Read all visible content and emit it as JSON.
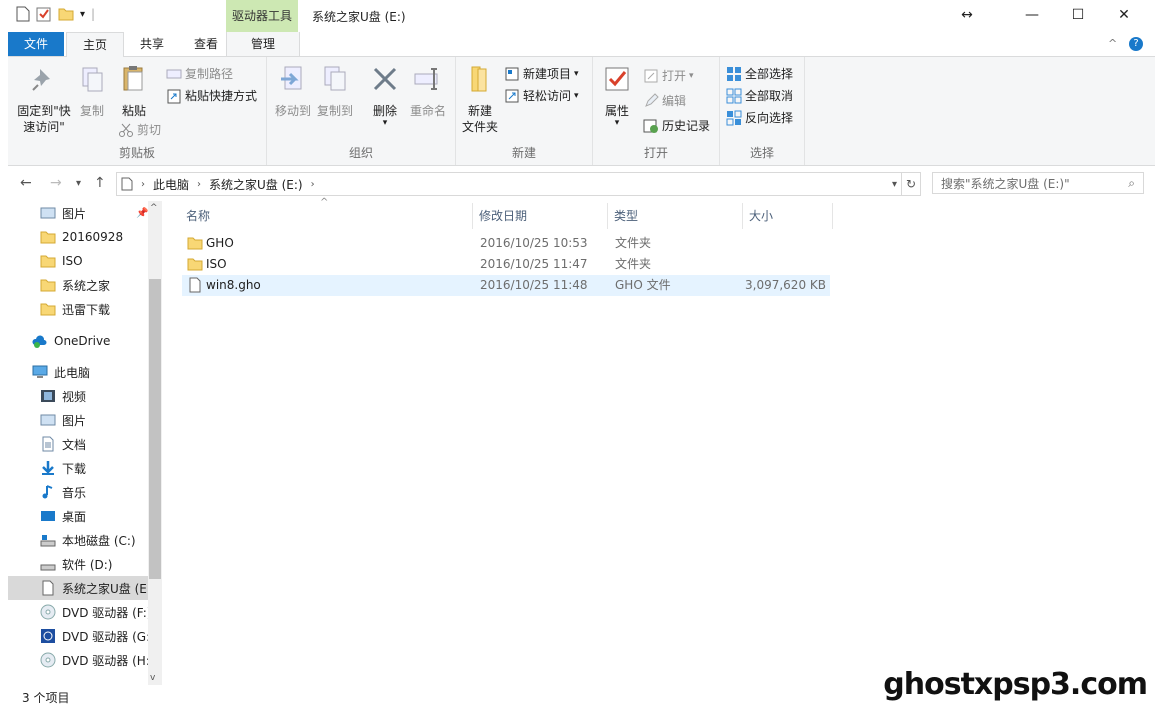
{
  "window": {
    "title": "系统之家U盘 (E:)",
    "tools_header": "驱动器工具",
    "minimize": "—",
    "maximize": "☐",
    "close": "✕",
    "resize_hint": "↔"
  },
  "tabs": {
    "file": "文件",
    "home": "主页",
    "share": "共享",
    "view": "查看",
    "manage": "管理"
  },
  "ribbon": {
    "clipboard": {
      "label": "剪贴板",
      "pin": "固定到\"快",
      "pin2": "速访问\"",
      "copy": "复制",
      "paste": "粘贴",
      "copy_path": "复制路径",
      "paste_shortcut": "粘贴快捷方式",
      "cut": "剪切"
    },
    "organize": {
      "label": "组织",
      "move_to": "移动到",
      "copy_to": "复制到",
      "delete": "删除",
      "rename": "重命名"
    },
    "new": {
      "label": "新建",
      "new_folder": "新建",
      "new_folder2": "文件夹",
      "new_item": "新建项目",
      "easy_access": "轻松访问"
    },
    "open": {
      "label": "打开",
      "properties": "属性",
      "open": "打开",
      "edit": "编辑",
      "history": "历史记录"
    },
    "select": {
      "label": "选择",
      "select_all": "全部选择",
      "select_none": "全部取消",
      "invert": "反向选择"
    }
  },
  "address": {
    "crumbs": [
      "此电脑",
      "系统之家U盘 (E:)"
    ],
    "search_placeholder": "搜索\"系统之家U盘 (E:)\""
  },
  "nav": {
    "quick": [
      "图片",
      "20160928",
      "ISO",
      "系统之家",
      "迅雷下载"
    ],
    "onedrive": "OneDrive",
    "pc": "此电脑",
    "pc_items": [
      "视频",
      "图片",
      "文档",
      "下载",
      "音乐",
      "桌面",
      "本地磁盘 (C:)",
      "软件 (D:)",
      "系统之家U盘 (E:",
      "DVD 驱动器 (F:)",
      "DVD 驱动器 (G:",
      "DVD 驱动器 (H:"
    ]
  },
  "columns": {
    "name": "名称",
    "modified": "修改日期",
    "type": "类型",
    "size": "大小"
  },
  "files": [
    {
      "name": "GHO",
      "modified": "2016/10/25 10:53",
      "type": "文件夹",
      "size": ""
    },
    {
      "name": "ISO",
      "modified": "2016/10/25 11:47",
      "type": "文件夹",
      "size": ""
    },
    {
      "name": "win8.gho",
      "modified": "2016/10/25 11:48",
      "type": "GHO 文件",
      "size": "3,097,620 KB"
    }
  ],
  "status": {
    "count": "3 个项目"
  },
  "watermark": "ghostxpsp3.com",
  "colors": {
    "file_tab": "#1979ca",
    "tools_tab": "#cde8b3",
    "selection": "#e5f3ff",
    "folder": "#f8d775"
  }
}
